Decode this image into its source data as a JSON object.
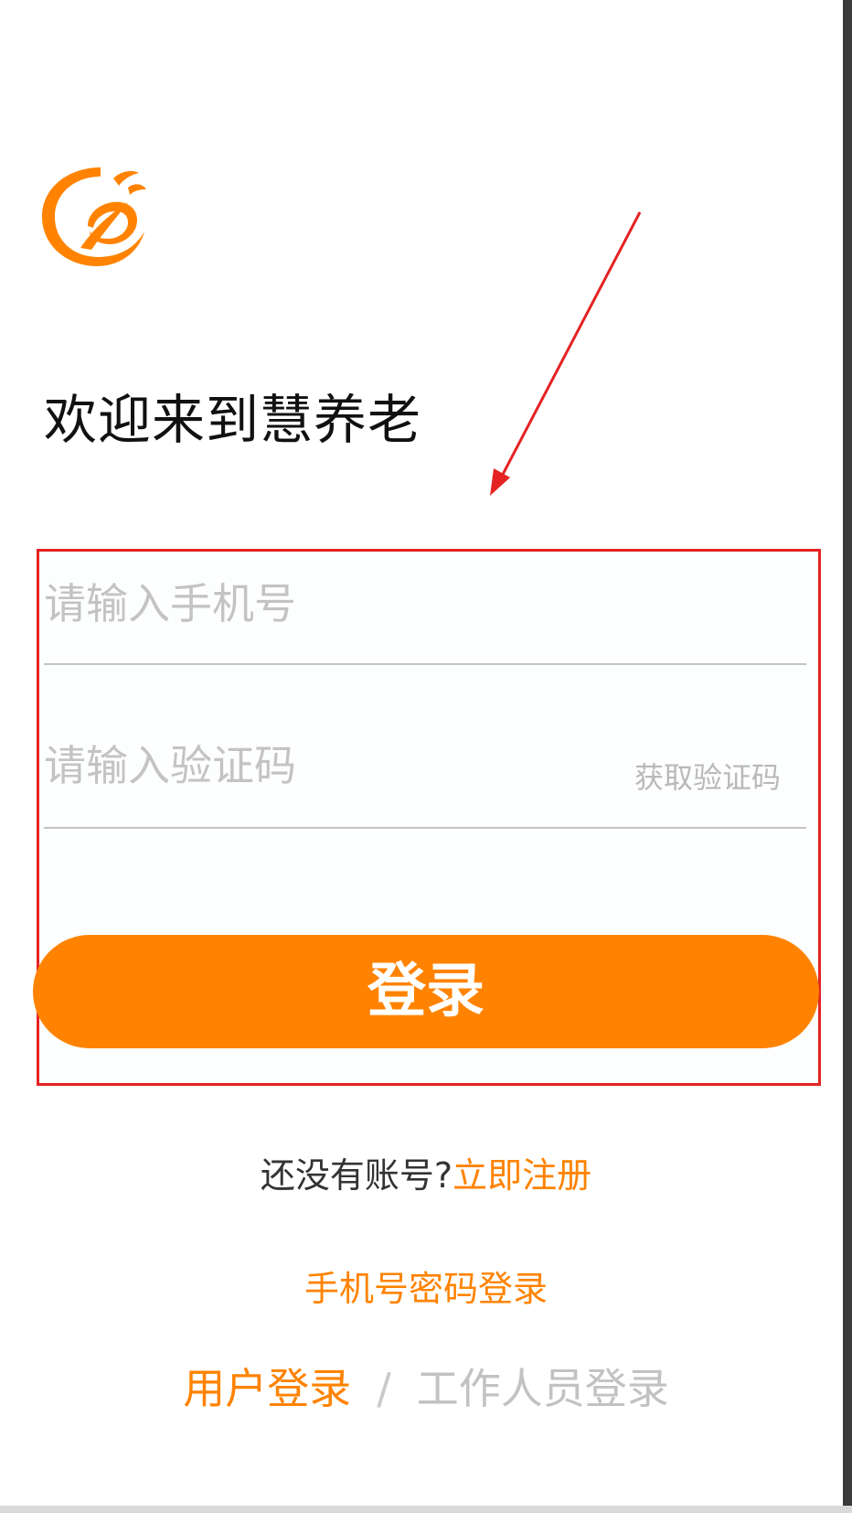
{
  "app": {
    "welcome_title": "欢迎来到慧养老",
    "logo_name": "app-logo"
  },
  "form": {
    "phone_placeholder": "请输入手机号",
    "code_placeholder": "请输入验证码",
    "get_code_label": "获取验证码",
    "login_button_label": "登录"
  },
  "register": {
    "prompt": "还没有账号?",
    "link_label": "立即注册"
  },
  "alt_login": {
    "password_login_label": "手机号密码登录"
  },
  "roles": {
    "user_label": "用户登录",
    "separator": "/",
    "staff_label": "工作人员登录"
  },
  "colors": {
    "accent": "#ff8300",
    "annotation": "#e52222"
  }
}
